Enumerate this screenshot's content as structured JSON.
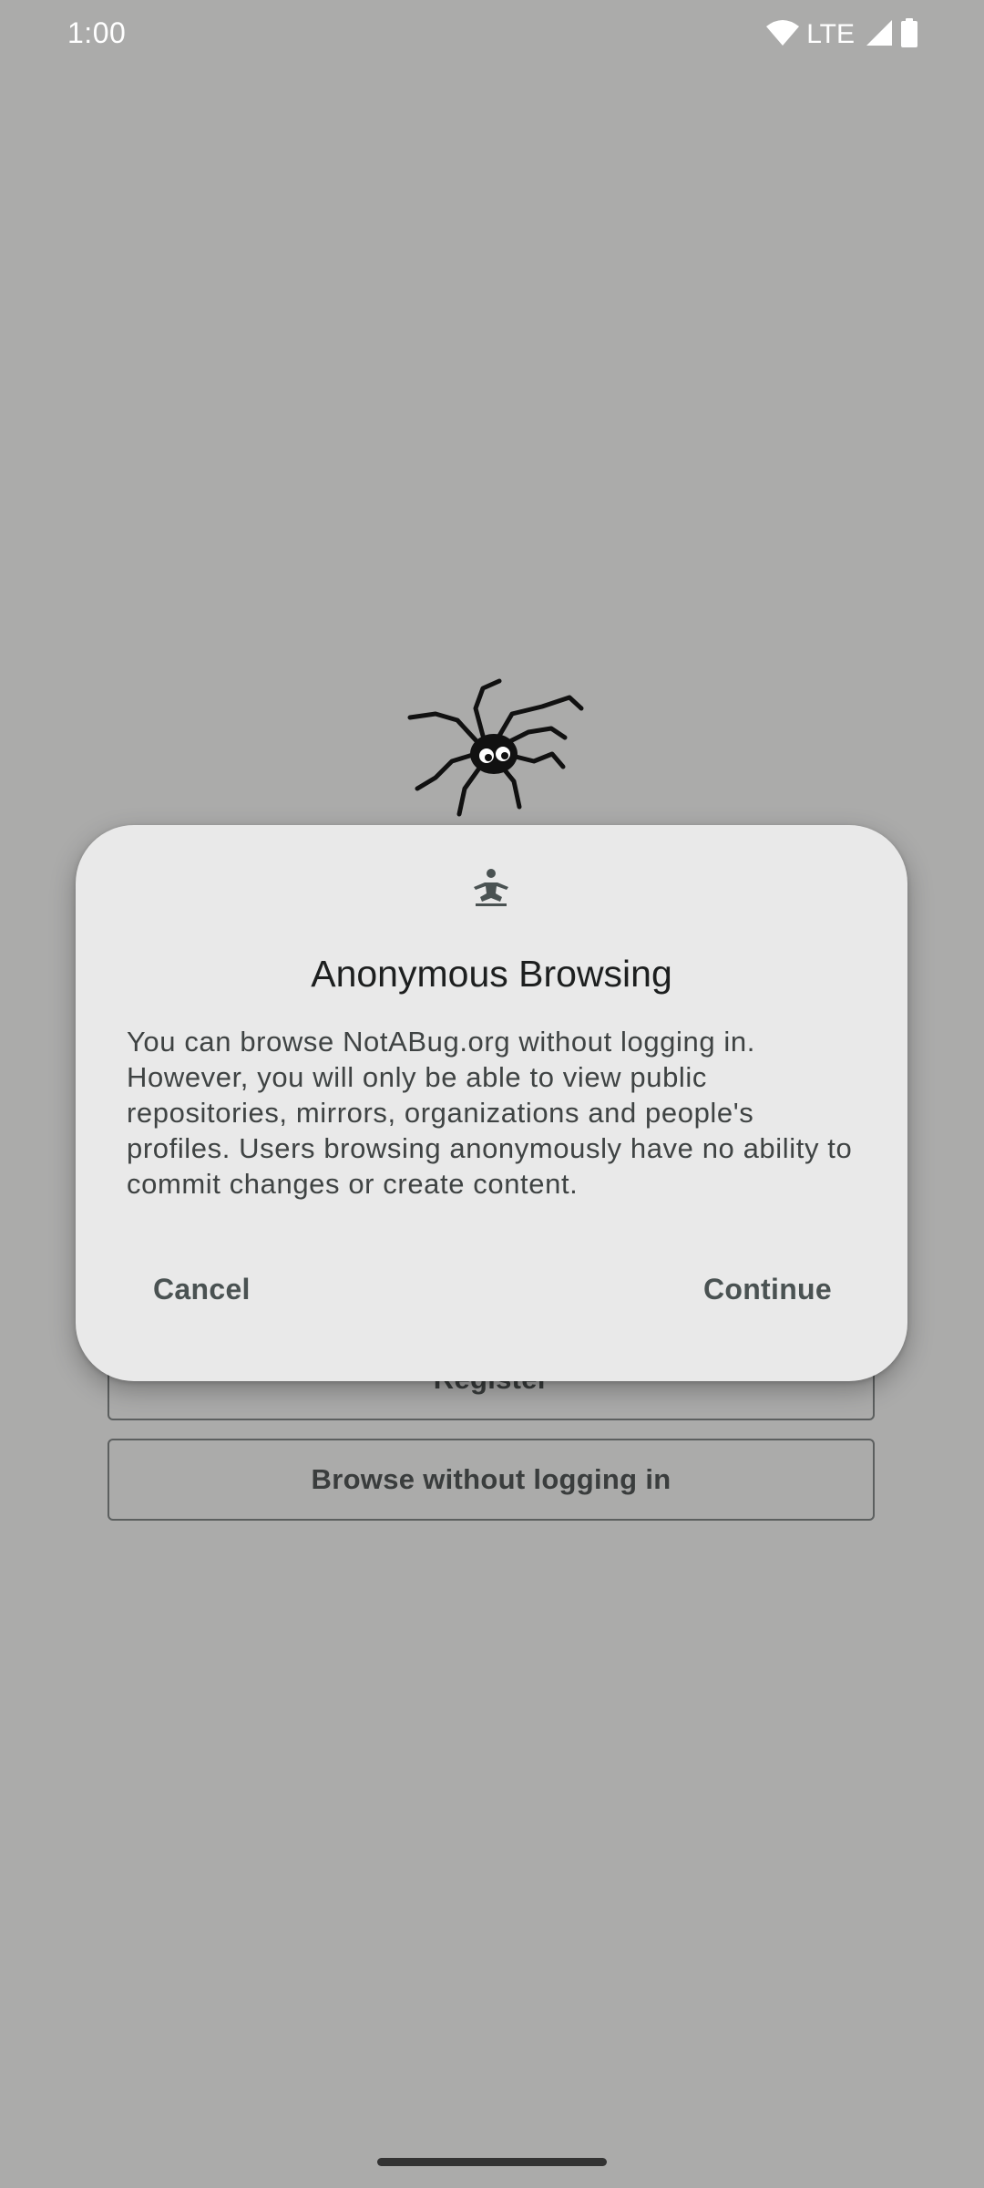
{
  "status_bar": {
    "time": "1:00",
    "network": "LTE",
    "icons": [
      "wifi-icon",
      "cell-signal-icon",
      "battery-icon"
    ]
  },
  "logo": {
    "icon": "spider-logo"
  },
  "background_buttons": {
    "register_label": "Register",
    "browse_label": "Browse without logging in"
  },
  "dialog": {
    "icon": "meditation-icon",
    "title": "Anonymous Browsing",
    "body": "You can browse NotABug.org without logging in. However, you will only be able to view public repositories, mirrors, organizations and people's profiles. Users browsing anonymously have no ability to commit changes or create content.",
    "cancel_label": "Cancel",
    "continue_label": "Continue"
  },
  "colors": {
    "scrim_background": "#ababaa",
    "dialog_background": "#e9e9e9",
    "text_primary": "#1d1f1f",
    "button_text": "#4a5252"
  }
}
